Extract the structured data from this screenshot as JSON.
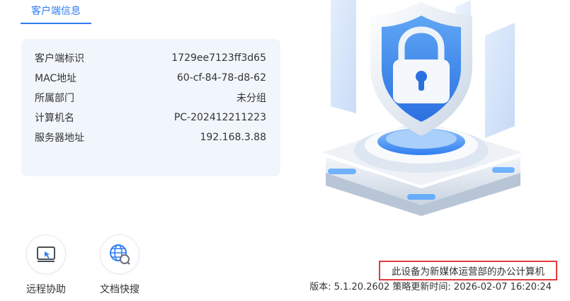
{
  "tab": {
    "label": "客户端信息"
  },
  "info": {
    "rows": [
      {
        "label": "客户端标识",
        "value": "1729ee7123ff3d65"
      },
      {
        "label": "MAC地址",
        "value": "60-cf-84-78-d8-62"
      },
      {
        "label": "所属部门",
        "value": "未分组"
      },
      {
        "label": "计算机名",
        "value": "PC-202412211223"
      },
      {
        "label": "服务器地址",
        "value": "192.168.3.88"
      }
    ]
  },
  "actions": [
    {
      "label": "远程协助",
      "icon": "remote-monitor-icon"
    },
    {
      "label": "文档快搜",
      "icon": "globe-search-icon"
    }
  ],
  "notice": {
    "text": "此设备为新媒体运营部的办公计算机"
  },
  "footer": {
    "text": "版本: 5.1.20.2602 策略更新时间: 2026-02-07 16:20:24"
  },
  "colors": {
    "accent": "#2f7df1",
    "notice_border": "#e23b3b",
    "card_bg": "#f1f6fc"
  }
}
